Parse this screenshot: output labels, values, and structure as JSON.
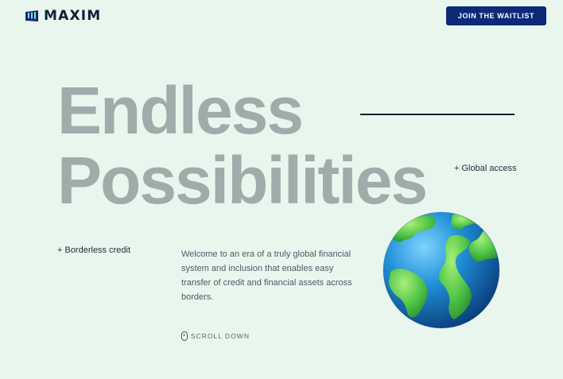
{
  "header": {
    "brand": "MAXIM",
    "logo_icon": "maxim-logo-icon",
    "cta_label": "JOIN THE WAITLIST",
    "cta_color": "#0c2a78"
  },
  "hero": {
    "title_line1": "Endless",
    "title_line2": "Possibilities",
    "title_color": "#9eadaa",
    "feature_global": "+ Global access",
    "feature_credit": "+ Borderless credit",
    "intro": "Welcome to an era of a truly global financial system and inclusion that enables easy transfer of credit and financial assets across borders.",
    "scroll_label": "SCROLL DOWN",
    "scroll_icon": "mouse-icon",
    "globe_icon": "globe-illustration"
  },
  "colors": {
    "background": "#e8f6ee",
    "text": "#1b2a3a"
  }
}
